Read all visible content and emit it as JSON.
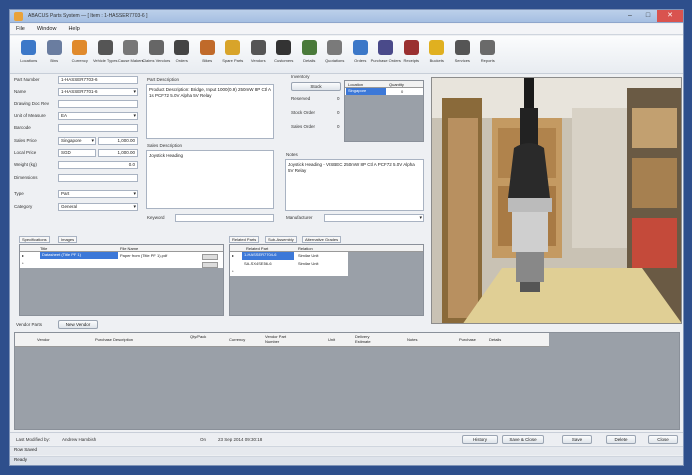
{
  "window": {
    "title": "ABACUS Parts System — [ Item : 1-HASSER7703-6 ]"
  },
  "menu": [
    "File",
    "Window",
    "Help"
  ],
  "toolbar": [
    {
      "label": "Locations",
      "icon": "globe-icon",
      "color": "#3c78c8"
    },
    {
      "label": "Bins",
      "icon": "bins-icon",
      "color": "#6a7da0"
    },
    {
      "label": "Currency",
      "icon": "currency-icon",
      "color": "#e08a2c"
    },
    {
      "label": "Vehicle Types",
      "icon": "vehicle-icon",
      "color": "#555"
    },
    {
      "label": "Cause Makers",
      "icon": "machine-icon",
      "color": "#777"
    },
    {
      "label": "Claims Vendors",
      "icon": "claims-icon",
      "color": "#666"
    },
    {
      "label": "Orders",
      "icon": "bottle-icon",
      "color": "#444"
    },
    {
      "label": "Bikes",
      "icon": "bike-icon",
      "color": "#c06a2a"
    },
    {
      "label": "Spare Parts",
      "icon": "parts-icon",
      "color": "#d8a42a"
    },
    {
      "label": "Vendors",
      "icon": "building-icon",
      "color": "#555"
    },
    {
      "label": "Customers",
      "icon": "person-icon",
      "color": "#333"
    },
    {
      "label": "Details",
      "icon": "pen-icon",
      "color": "#4a7a3a"
    },
    {
      "label": "Quotations",
      "icon": "clipboard-icon",
      "color": "#7a7a7a"
    },
    {
      "label": "Orders",
      "icon": "document-icon",
      "color": "#3c78c8"
    },
    {
      "label": "Purchase Orders",
      "icon": "purchase-icon",
      "color": "#4a4a8a"
    },
    {
      "label": "Receipts",
      "icon": "receipt-icon",
      "color": "#9a3030"
    },
    {
      "label": "Buckets",
      "icon": "bucket-icon",
      "color": "#e0b020"
    },
    {
      "label": "Services",
      "icon": "service-icon",
      "color": "#555"
    },
    {
      "label": "Reports",
      "icon": "report-icon",
      "color": "#6a6a6a"
    }
  ],
  "form": {
    "part_number_label": "Part Number",
    "part_number": "1-HASSER7703-6",
    "name_label": "Name",
    "name": "1-HASSER7701-6",
    "drawing_label": "Drawing Doc Rev",
    "drawing": "",
    "uom_label": "Unit of Measure",
    "uom": "EA",
    "barcode_label": "Barcode",
    "barcode": "",
    "sales_price_label": "Sales Price",
    "sales_currency": "Singapore",
    "sales_price": "1,000.00",
    "local_price_label": "Local Price",
    "local_currency": "SGD",
    "local_price": "1,000.00",
    "weight_label": "Weight (kg)",
    "weight": "0.0",
    "dimensions_label": "Dimensions",
    "dimensions": "",
    "type_label": "Type",
    "type": "Part",
    "category_label": "Category",
    "category": "General"
  },
  "description": {
    "part_label": "Part Description",
    "part": "Product Description: Bridge, Input 1000(0.9) 250mW 8P Ctl A 1s PCF72 5.0V Alpha 5V Relay",
    "sales_label": "Sales Description",
    "sales": "Joystick Heading",
    "keyword_label": "Keyword",
    "keyword": ""
  },
  "inventory": {
    "label": "Inventory",
    "btn": "Stock",
    "rows": [
      {
        "label": "Reserved",
        "value": "0"
      },
      {
        "label": "Stock Order",
        "value": "0"
      },
      {
        "label": "Sales Order",
        "value": "0"
      }
    ],
    "loc_headers": [
      "Location",
      "Quantity"
    ],
    "loc_rows": [
      [
        "Singapore",
        "0"
      ]
    ]
  },
  "notes": {
    "label": "Notes",
    "text": "Joystick Heading - VISBEC 250mW 8P Ctl A PCF72 5.0V Alpha 5V Relay",
    "manufacturer_label": "Manufacturer",
    "manufacturer": ""
  },
  "specs": {
    "tab1": "Specifications",
    "tab2": "Images",
    "headers": [
      "Title",
      "File Name"
    ],
    "rows": [
      [
        "Datasheet (Title PF 1)",
        "Paper from (Title PF 1).pdf"
      ]
    ]
  },
  "related": {
    "tab1": "Related Parts",
    "tab2": "Sub-Assembly",
    "tab3": "Alternative Grades",
    "headers": [
      "Related Part",
      "Relation"
    ],
    "rows": [
      [
        "1-HASSER7704-6",
        "Similar Unit"
      ],
      [
        "SA-SX4SE56-6",
        "Similar Unit"
      ]
    ]
  },
  "vendor": {
    "label": "Vendor Parts",
    "btn": "New Vendor",
    "headers": [
      "Vendor",
      "Purchase Description",
      "Qty/Pack",
      "Currency",
      "Vendor Part Number",
      "Unit",
      "Delivery Estimate",
      "Notes",
      "Purchase",
      "Details"
    ]
  },
  "footer": {
    "modified_label": "Last Modified by:",
    "modified_by": "Andrew Hambish",
    "on_label": "On",
    "modified_on": "23 Sep 2014 09:30:18",
    "buttons": [
      "History",
      "Save & Close",
      "Save",
      "Delete",
      "Close"
    ]
  },
  "status": {
    "line1": "Row Saved",
    "line2": "Ready"
  },
  "colors": {
    "frame": "#2e4f8c",
    "grid_bg": "#9aa0a8",
    "selected": "#3c78d8"
  }
}
